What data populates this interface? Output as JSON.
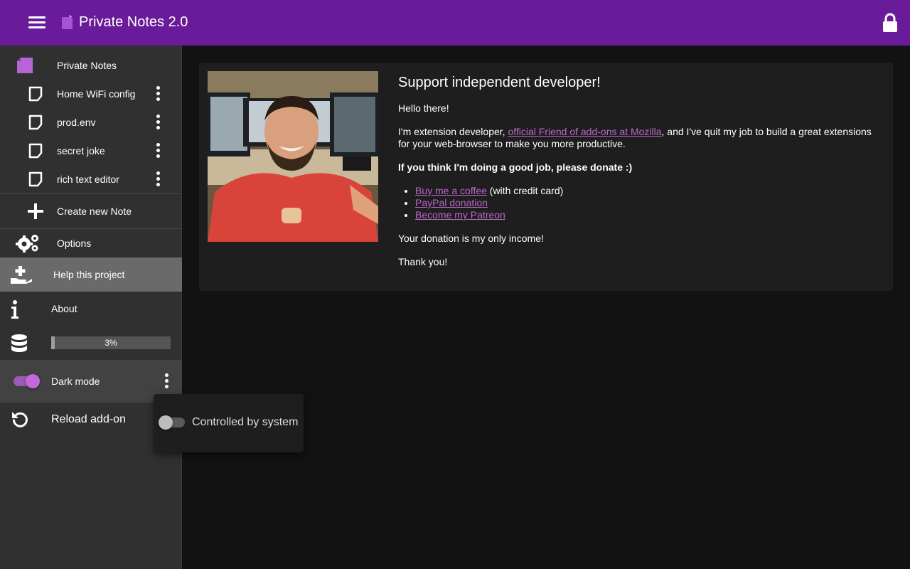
{
  "header": {
    "title": "Private Notes 2.0",
    "menu_icon": "hamburger-icon",
    "lock_icon": "lock-icon",
    "accent_color": "#6a1b9a"
  },
  "sidebar": {
    "root_item": {
      "label": "Private Notes",
      "icon": "notebook-icon"
    },
    "notes": [
      {
        "label": "Home WiFi config"
      },
      {
        "label": "prod.env"
      },
      {
        "label": "secret joke"
      },
      {
        "label": "rich text editor"
      }
    ],
    "create_label": "Create new Note",
    "options_label": "Options",
    "help_label": "Help this project",
    "about_label": "About",
    "storage": {
      "percent_text": "3%",
      "fraction": 0.03
    },
    "dark_mode_label": "Dark mode",
    "dark_mode_on": true,
    "reload_label": "Reload add-on"
  },
  "popup": {
    "label": "Controlled by system",
    "on": false
  },
  "support": {
    "heading": "Support independent developer!",
    "greeting": "Hello there!",
    "intro_before": "I'm extension developer, ",
    "intro_link": "official Friend of add-ons at Mozilla",
    "intro_after": ", and I've quit my job to build a great extensions for your web-browser to make you more productive.",
    "donate_prompt": "If you think I'm doing a good job, please donate :)",
    "links": [
      {
        "text": "Buy me a coffee",
        "suffix": " (with credit card)"
      },
      {
        "text": "PayPal donation",
        "suffix": ""
      },
      {
        "text": "Become my Patreon",
        "suffix": ""
      }
    ],
    "income_note": "Your donation is my only income!",
    "thanks": "Thank you!"
  }
}
